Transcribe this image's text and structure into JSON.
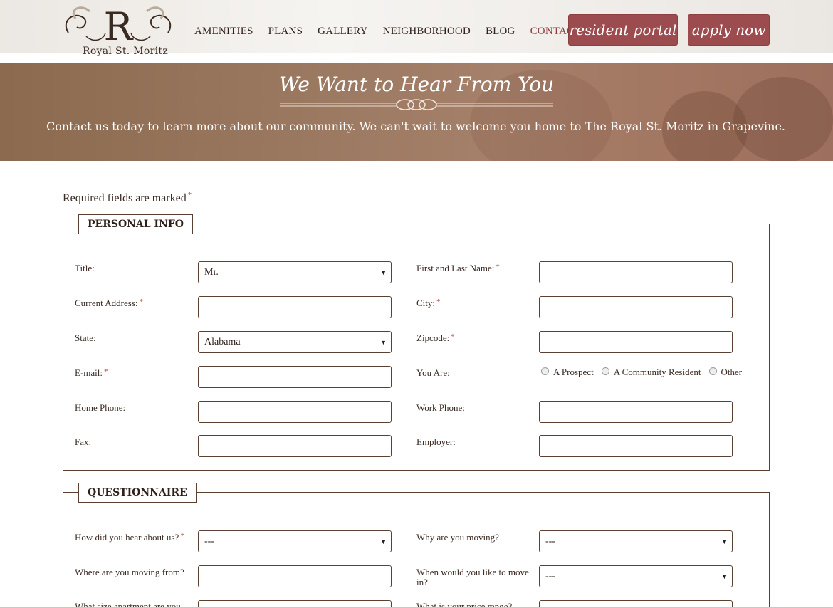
{
  "brand": {
    "logo_text": "Royal St. Moritz",
    "logo_mark": "R"
  },
  "nav": {
    "items": [
      {
        "label": "AMENITIES"
      },
      {
        "label": "PLANS"
      },
      {
        "label": "GALLERY"
      },
      {
        "label": "NEIGHBORHOOD"
      },
      {
        "label": "BLOG"
      },
      {
        "label": "CONTACT",
        "active": true
      }
    ]
  },
  "header": {
    "resident_portal_label": "resident portal",
    "apply_now_label": "apply now"
  },
  "hero": {
    "title": "We Want to Hear From You",
    "text": "Contact us today to learn more about our community. We can't wait to welcome you home to The Royal St. Moritz in Grapevine."
  },
  "form": {
    "required_note": "Required fields are marked",
    "required_mark": "*",
    "personal": {
      "legend": "PERSONAL INFO",
      "title_label": "Title:",
      "title_value": "Mr.",
      "name_label": "First and Last Name:",
      "address_label": "Current Address:",
      "city_label": "City:",
      "state_label": "State:",
      "state_value": "Alabama",
      "zip_label": "Zipcode:",
      "email_label": "E-mail:",
      "you_are_label": "You Are:",
      "you_are_options": [
        "A Prospect",
        "A Community Resident",
        "Other"
      ],
      "home_phone_label": "Home Phone:",
      "work_phone_label": "Work Phone:",
      "fax_label": "Fax:",
      "employer_label": "Employer:"
    },
    "questionnaire": {
      "legend": "QUESTIONNAIRE",
      "hear_label": "How did you hear about us?",
      "hear_value": "---",
      "why_label": "Why are you moving?",
      "why_value": "---",
      "from_label": "Where are you moving from?",
      "when_label": "When would you like to move in?",
      "when_value": "---",
      "size_label": "What size apartment are you",
      "price_label": "What is your price range?"
    }
  },
  "colors": {
    "accent": "#9c4c4e",
    "text": "#3a2a22",
    "border": "#5a4033",
    "required": "#c0392b"
  }
}
